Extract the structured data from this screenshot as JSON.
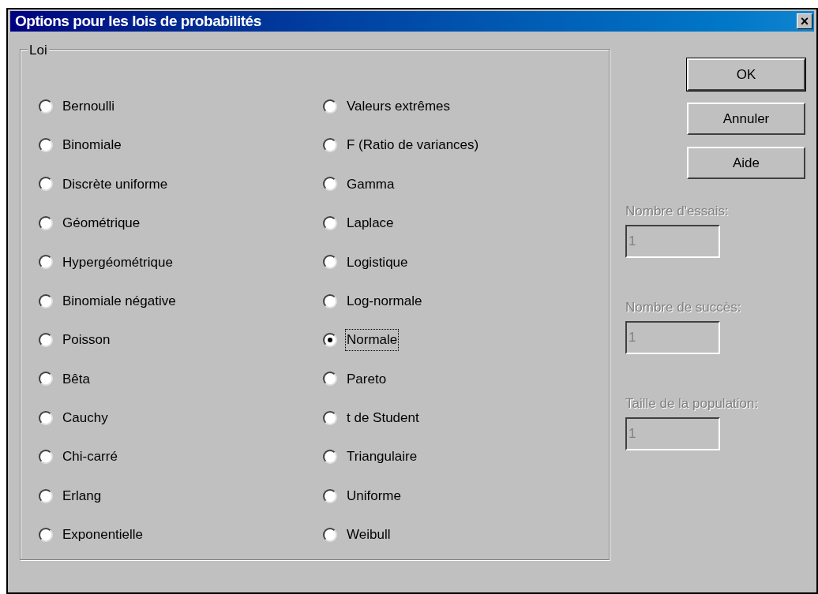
{
  "window": {
    "title": "Options pour les lois de probabilités",
    "close": "×"
  },
  "group": {
    "title": "Loi",
    "options": [
      {
        "label": "Bernoulli",
        "selected": false
      },
      {
        "label": "Binomiale",
        "selected": false
      },
      {
        "label": "Discrète uniforme",
        "selected": false
      },
      {
        "label": "Géométrique",
        "selected": false
      },
      {
        "label": "Hypergéométrique",
        "selected": false
      },
      {
        "label": "Binomiale négative",
        "selected": false
      },
      {
        "label": "Poisson",
        "selected": false
      },
      {
        "label": "Bêta",
        "selected": false
      },
      {
        "label": "Cauchy",
        "selected": false
      },
      {
        "label": "Chi-carré",
        "selected": false
      },
      {
        "label": "Erlang",
        "selected": false
      },
      {
        "label": "Exponentielle",
        "selected": false
      },
      {
        "label": "Valeurs extrêmes",
        "selected": false
      },
      {
        "label": "F (Ratio de variances)",
        "selected": false
      },
      {
        "label": "Gamma",
        "selected": false
      },
      {
        "label": "Laplace",
        "selected": false
      },
      {
        "label": "Logistique",
        "selected": false
      },
      {
        "label": "Log-normale",
        "selected": false
      },
      {
        "label": "Normale",
        "selected": true
      },
      {
        "label": "Pareto",
        "selected": false
      },
      {
        "label": "t de Student",
        "selected": false
      },
      {
        "label": "Triangulaire",
        "selected": false
      },
      {
        "label": "Uniforme",
        "selected": false
      },
      {
        "label": "Weibull",
        "selected": false
      }
    ]
  },
  "buttons": [
    {
      "label": "OK",
      "default": true
    },
    {
      "label": "Annuler",
      "default": false
    },
    {
      "label": "Aide",
      "default": false
    }
  ],
  "fields": [
    {
      "label": "Nombre d'essais:",
      "value": "1",
      "disabled": true
    },
    {
      "label": "Nombre de succès:",
      "value": "1",
      "disabled": true
    },
    {
      "label": "Taille de la population:",
      "value": "1",
      "disabled": true
    }
  ]
}
